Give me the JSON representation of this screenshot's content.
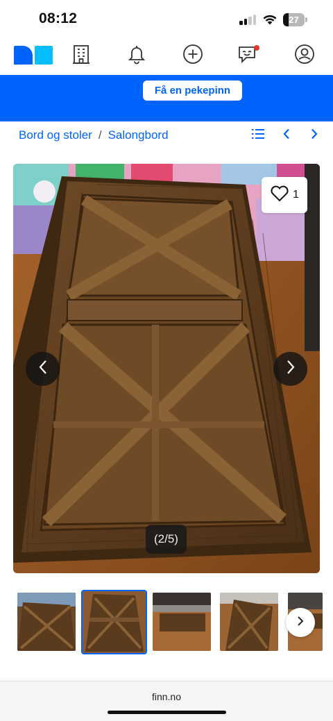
{
  "status_bar": {
    "time": "08:12",
    "battery_level": "27",
    "battery_fraction": 0.27
  },
  "nav": {
    "icons": [
      "finn-logo",
      "building-icon",
      "bell-icon",
      "plus-circle-icon",
      "chat-icon",
      "profile-icon"
    ],
    "chat_has_notification": true
  },
  "banner": {
    "button_label": "Få en pekepinn"
  },
  "breadcrumb": {
    "parent": "Bord og stoler",
    "separator": "/",
    "current": "Salongbord"
  },
  "gallery": {
    "favorite_count": "1",
    "counter": "(2/5)",
    "current_index": 2,
    "total": 5
  },
  "thumbnails": {
    "count": 5,
    "active_index": 1
  },
  "browser": {
    "url": "finn.no"
  },
  "colors": {
    "brand_blue": "#0063fb",
    "notification_red": "#e8332b"
  }
}
